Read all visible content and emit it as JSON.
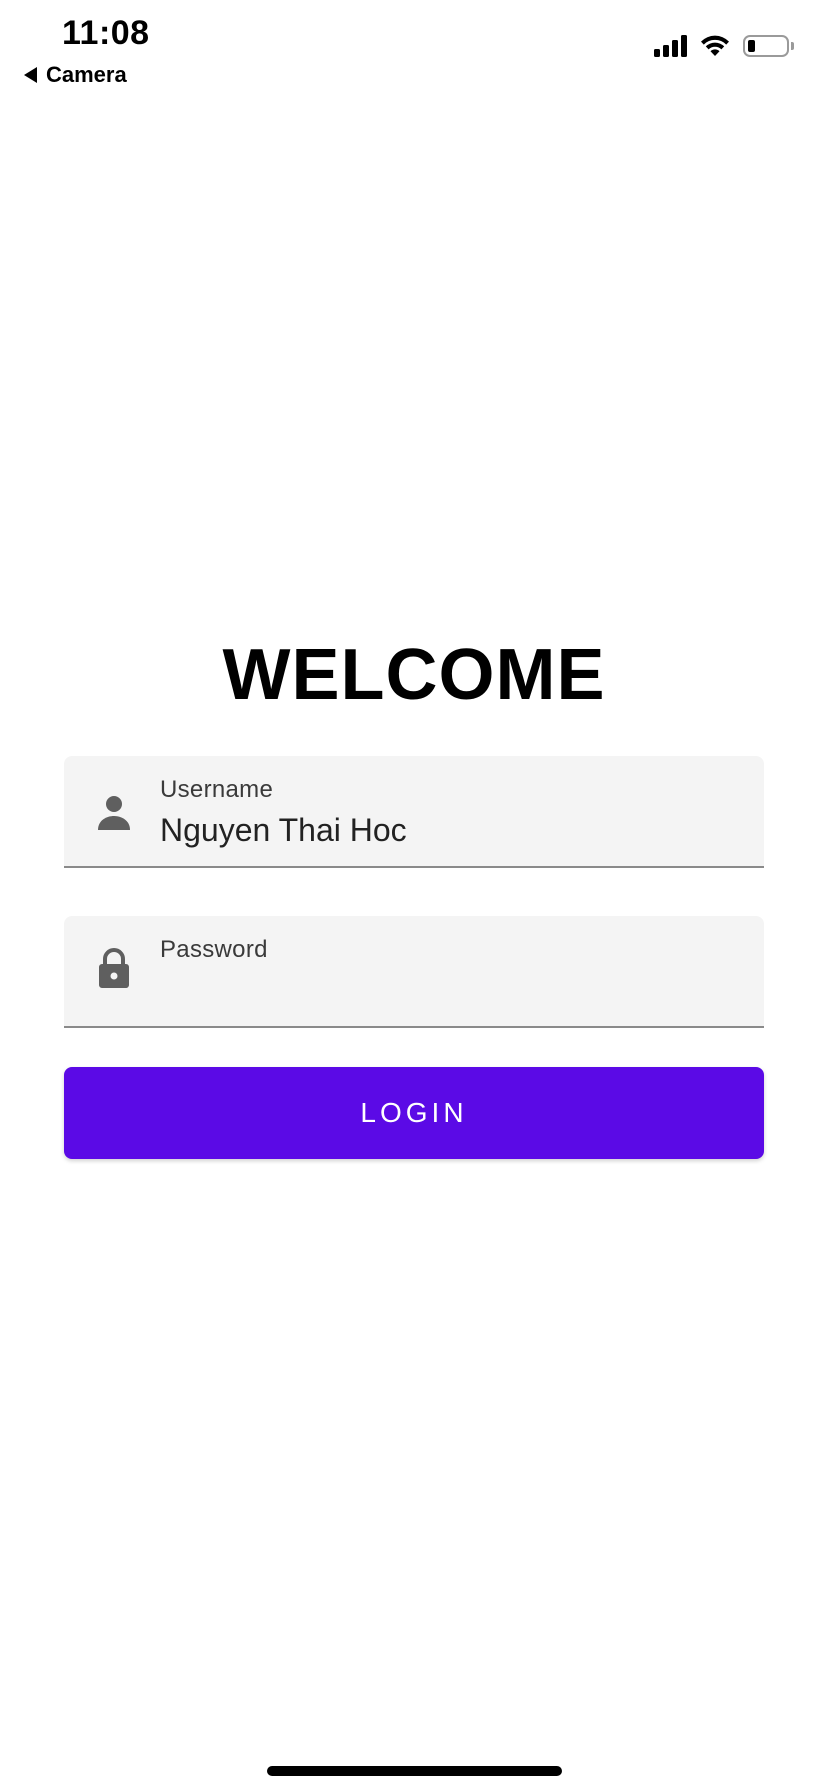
{
  "status_bar": {
    "time": "11:08",
    "back_app": "Camera",
    "signal_bars": 4,
    "battery_level": 0.2
  },
  "screen": {
    "title": "WELCOME",
    "username": {
      "label": "Username",
      "value": "Nguyen Thai Hoc",
      "icon": "person-icon"
    },
    "password": {
      "label": "Password",
      "value": "",
      "icon": "lock-icon"
    },
    "login_button": "LOGIN"
  },
  "colors": {
    "primary": "#5b0ae6",
    "field_background": "#f4f4f4",
    "icon": "#5f5f5f"
  }
}
